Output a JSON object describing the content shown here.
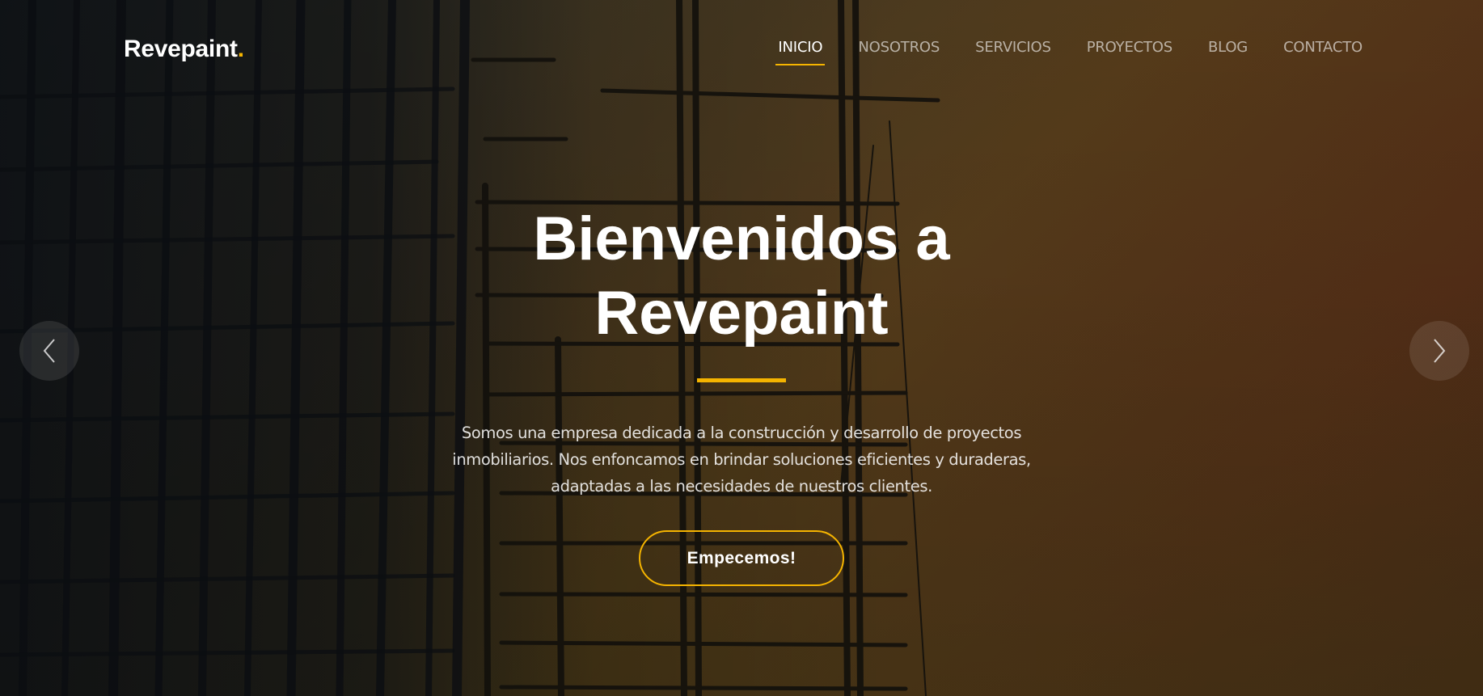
{
  "brand": {
    "name": "Revepaint",
    "dot": "."
  },
  "nav": [
    {
      "label": "INICIO",
      "active": true
    },
    {
      "label": "NOSOTROS",
      "active": false
    },
    {
      "label": "SERVICIOS",
      "active": false
    },
    {
      "label": "PROYECTOS",
      "active": false
    },
    {
      "label": "BLOG",
      "active": false
    },
    {
      "label": "CONTACTO",
      "active": false
    }
  ],
  "hero": {
    "title": "Bienvenidos a Revepaint",
    "description": "Somos una empresa dedicada a la construcción y desarrollo de proyectos inmobiliarios. Nos enfoncamos en brindar soluciones eficientes y duraderas, adaptadas a las necesidades de nuestros clientes.",
    "cta_label": "Empecemos!"
  },
  "carousel": {
    "prev_icon": "chevron-left-icon",
    "next_icon": "chevron-right-icon"
  },
  "colors": {
    "accent": "#f5b400",
    "text": "#ffffff"
  }
}
